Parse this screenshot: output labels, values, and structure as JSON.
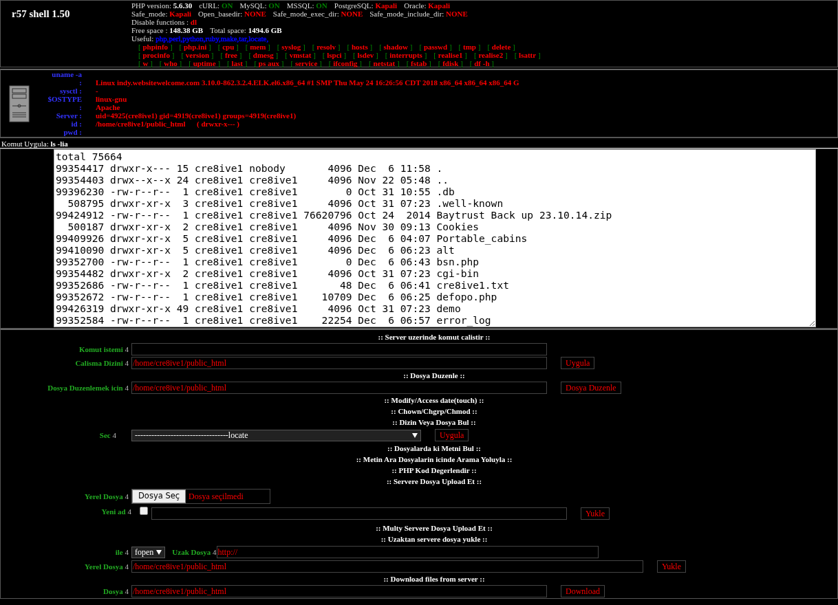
{
  "title": "r57 shell 1.50",
  "info_lines": [
    [
      {
        "label": "PHP version: ",
        "value": "5.6.30",
        "color": "#ffffff"
      },
      {
        "label": "cURL: ",
        "value": "ON",
        "color": "#008000"
      },
      {
        "label": "MySQL: ",
        "value": "ON",
        "color": "#008000"
      },
      {
        "label": "MSSQL: ",
        "value": "ON",
        "color": "#008000"
      },
      {
        "label": "PostgreSQL: ",
        "value": "Kapali",
        "color": "#ff0000"
      },
      {
        "label": "Oracle: ",
        "value": "Kapali",
        "color": "#ff0000"
      }
    ],
    [
      {
        "label": "Safe_mode: ",
        "value": "Kapali",
        "color": "#ff0000"
      },
      {
        "label": "Open_basedir: ",
        "value": "NONE",
        "color": "#ff0000"
      },
      {
        "label": "Safe_mode_exec_dir: ",
        "value": "NONE",
        "color": "#ff0000"
      },
      {
        "label": "Safe_mode_include_dir: ",
        "value": "NONE",
        "color": "#ff0000"
      }
    ],
    [
      {
        "label": "Disable functions : ",
        "value": "dl",
        "color": "#ff0000"
      }
    ],
    [
      {
        "label": "Free space : ",
        "value": "148.38 GB",
        "color": "#ffffff"
      },
      {
        "label": "Total space: ",
        "value": "1494.6 GB",
        "color": "#ffffff"
      }
    ],
    [
      {
        "label": "Useful: ",
        "value": "php,perl,python,ruby,make,tar,locate,",
        "color": "#0000ff"
      }
    ]
  ],
  "link_brackets": [
    "[",
    "]"
  ],
  "command_links": [
    [
      "phpinfo",
      "php.ini",
      "cpu",
      "mem",
      "syslog",
      "resolv",
      "hosts",
      "shadow",
      "passwd",
      "tmp",
      "delete"
    ],
    [
      "procinfo",
      "version",
      "free",
      "dmesg",
      "vmstat",
      "lspci",
      "lsdev",
      "interrupts",
      "realise1",
      "realise2",
      "lsattr"
    ],
    [
      "w",
      "who",
      "uptime",
      "last",
      "ps aux",
      "service",
      "ifconfig",
      "netstat",
      "fstab",
      "fdisk",
      "df -h"
    ]
  ],
  "system_info": [
    {
      "label": "uname -a"
    },
    {
      "label": ":",
      "value": "Linux indy.websitewelcome.com 3.10.0-862.3.2.4.ELK.el6.x86_64 #1 SMP Thu May 24 16:26:56 CDT 2018 x86_64 x86_64 x86_64 G"
    },
    {
      "label": "sysctl :",
      "value": "-"
    },
    {
      "label": "$OSTYPE",
      "value": "linux-gnu"
    },
    {
      "label": ":",
      "value": "Apache"
    },
    {
      "label": "Server :",
      "value": "uid=4925(cre8ive1) gid=4919(cre8ive1) groups=4919(cre8ive1)"
    },
    {
      "label": "id :",
      "value": "/home/cre8ive1/public_html      ( drwxr-x--- )"
    },
    {
      "label": "pwd :"
    }
  ],
  "command_bar": {
    "label": "Komut Uygula: ",
    "command": "ls -lia"
  },
  "output_lines": [
    "total 75664",
    "99354417 drwxr-x--- 15 cre8ive1 nobody       4096 Dec  6 11:58 .",
    "99354403 drwx--x--x 24 cre8ive1 cre8ive1     4096 Nov 22 05:48 ..",
    "99396230 -rw-r--r--  1 cre8ive1 cre8ive1        0 Oct 31 10:55 .db",
    "  508795 drwxr-xr-x  3 cre8ive1 cre8ive1     4096 Oct 31 07:23 .well-known",
    "99424912 -rw-r--r--  1 cre8ive1 cre8ive1 76620796 Oct 24  2014 Baytrust Back up 23.10.14.zip",
    "  500187 drwxr-xr-x  2 cre8ive1 cre8ive1     4096 Nov 30 09:13 Cookies",
    "99409926 drwxr-xr-x  5 cre8ive1 cre8ive1     4096 Dec  6 04:07 Portable_cabins",
    "99410090 drwxr-xr-x  5 cre8ive1 cre8ive1     4096 Dec  6 06:23 alt",
    "99352700 -rw-r--r--  1 cre8ive1 cre8ive1        0 Dec  6 06:43 bsn.php",
    "99354482 drwxr-xr-x  2 cre8ive1 cre8ive1     4096 Oct 31 07:23 cgi-bin",
    "99352686 -rw-r--r--  1 cre8ive1 cre8ive1       48 Dec  6 06:41 cre8ive1.txt",
    "99352672 -rw-r--r--  1 cre8ive1 cre8ive1    10709 Dec  6 06:25 defopo.php",
    "99426319 drwxr-xr-x 49 cre8ive1 cre8ive1     4096 Oct 31 07:23 demo",
    "99352584 -rw-r--r--  1 cre8ive1 cre8ive1    22254 Dec  6 06:57 error_log"
  ],
  "form_rows": [
    {
      "kind": "heading",
      "text": ":: Server uzerinde komut calistir ::"
    },
    {
      "kind": "field",
      "label": "Komut istemi",
      "arrow": "4"
    },
    {
      "kind": "field",
      "label": "Calisma Dizini",
      "arrow": "4",
      "value": "/home/cre8ive1/public_html",
      "button": "Uygula"
    },
    {
      "kind": "heading",
      "text": ":: Dosya Duzenle ::"
    },
    {
      "kind": "field",
      "label": "Dosya Duzenlemek icin",
      "arrow": "4",
      "value": "/home/cre8ive1/public_html",
      "button": "Dosya Duzenle"
    },
    {
      "kind": "heading",
      "text": ":: Modify/Access date(touch) ::"
    },
    {
      "kind": "heading",
      "text": ":: Chown/Chgrp/Chmod ::"
    },
    {
      "kind": "heading",
      "text": ":: Dizin Veya Dosya Bul ::"
    },
    {
      "kind": "select",
      "label": "Sec",
      "arrow": "4",
      "value": "----------------------------------locate",
      "button": "Uygula"
    },
    {
      "kind": "heading",
      "text": ":: Dosyalarda ki Metni Bul ::"
    },
    {
      "kind": "heading",
      "text": ":: Metin Ara Dosyalarin icinde Arama Yoluyla ::"
    },
    {
      "kind": "heading",
      "text": ":: PHP Kod Degerlendir ::"
    },
    {
      "kind": "heading",
      "text": ":: Servere Dosya Upload Et ::"
    },
    {
      "kind": "file",
      "label": "Yerel Dosya",
      "arrow": "4",
      "button": "Dosya Seç",
      "status": "Dosya seçilmedi"
    },
    {
      "kind": "checkbox",
      "label": "Yeni ad",
      "arrow": "4",
      "checked": false,
      "button": "Yukle"
    },
    {
      "kind": "heading",
      "text": ":: Multy Servere Dosya Upload Et ::"
    },
    {
      "kind": "heading",
      "text": ":: Uzaktan servere dosya yukle ::"
    },
    {
      "kind": "remote",
      "label": "ile",
      "arrow": "4",
      "method": "fopen",
      "remote_label": "Uzak Dosya",
      "remote_arrow": "4",
      "value": "http://"
    },
    {
      "kind": "wide",
      "label": "Yerel Dosya",
      "arrow": "4",
      "value": "/home/cre8ive1/public_html",
      "button": "Yukle"
    },
    {
      "kind": "heading",
      "text": ":: Download files from server ::"
    },
    {
      "kind": "field",
      "label": "Dosya",
      "arrow": "4",
      "value": "/home/cre8ive1/public_html",
      "button": "Download"
    }
  ]
}
